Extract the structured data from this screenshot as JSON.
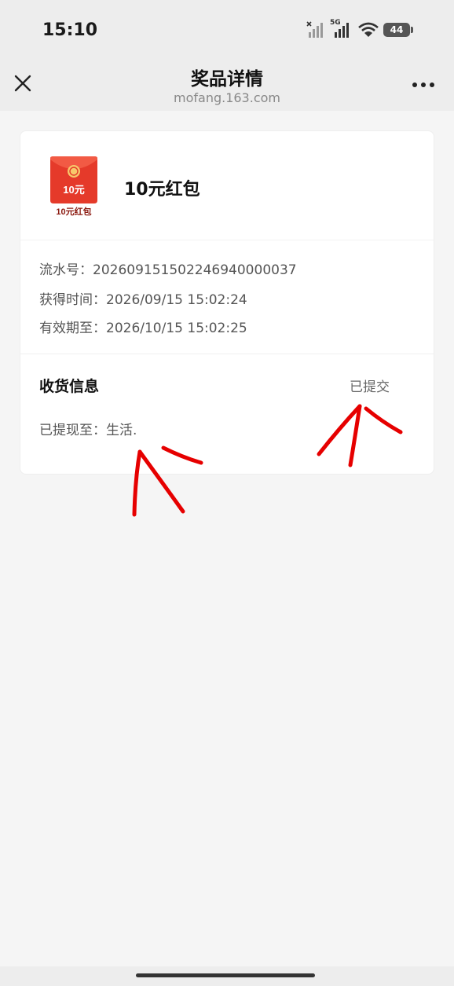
{
  "status_bar": {
    "time": "15:10",
    "network": "5G",
    "battery": "44"
  },
  "nav": {
    "title": "奖品详情",
    "subtitle": "mofang.163.com"
  },
  "prize": {
    "name": "10元红包",
    "icon_text": "10元",
    "icon_caption": "10元红包"
  },
  "details": {
    "serial": "流水号：202609151502246940000037",
    "obtained_time": "获得时间：2026/09/15 15:02:24",
    "valid_until": "有效期至：2026/10/15 15:02:25"
  },
  "shipping": {
    "title": "收货信息",
    "status": "已提交",
    "note": "已提现至：生活."
  },
  "colors": {
    "accent_red": "#e53a2a",
    "annotation_red": "#e60000"
  }
}
